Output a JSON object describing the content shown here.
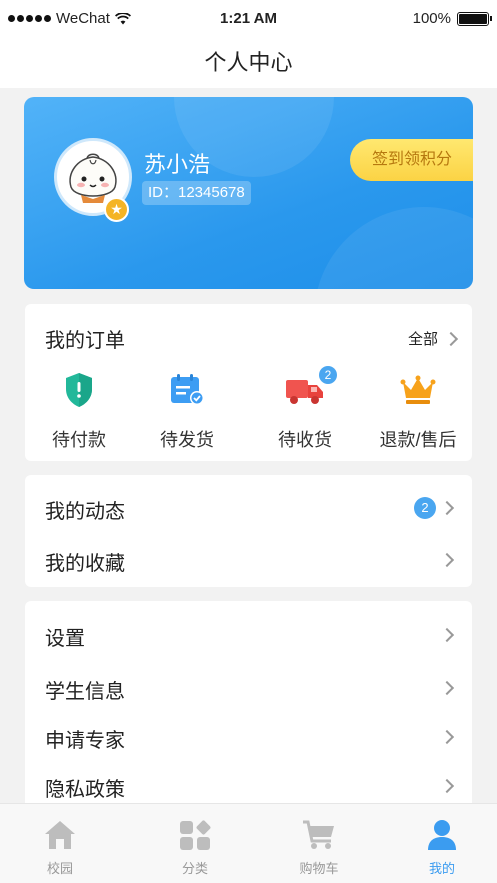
{
  "status_bar": {
    "carrier": "WeChat",
    "time": "1:21 AM",
    "battery": "100%"
  },
  "nav": {
    "title": "个人中心"
  },
  "profile": {
    "name": "苏小浩",
    "id_text": "ID：12345678",
    "checkin_label": "签到领积分"
  },
  "orders": {
    "title": "我的订单",
    "all_label": "全部",
    "items": [
      {
        "label": "待付款",
        "icon": "shield-icon",
        "color": "#22b89a"
      },
      {
        "label": "待发货",
        "icon": "calendar-check-icon",
        "color": "#3d9df3"
      },
      {
        "label": "待收货",
        "icon": "truck-icon",
        "color": "#f0544f",
        "badge": "2"
      },
      {
        "label": "退款/售后",
        "icon": "crown-icon",
        "color": "#f7a21b"
      }
    ]
  },
  "activity": {
    "items": [
      {
        "label": "我的动态",
        "badge": "2"
      },
      {
        "label": "我的收藏"
      }
    ]
  },
  "settings": {
    "items": [
      {
        "label": "设置"
      },
      {
        "label": "学生信息"
      },
      {
        "label": "申请专家"
      },
      {
        "label": "隐私政策"
      }
    ]
  },
  "tabbar": {
    "items": [
      {
        "label": "校园",
        "icon": "home-icon"
      },
      {
        "label": "分类",
        "icon": "category-icon"
      },
      {
        "label": "购物车",
        "icon": "cart-icon"
      },
      {
        "label": "我的",
        "icon": "user-icon",
        "active": true
      }
    ],
    "active_color": "#3b9cf0",
    "inactive_color": "#bdbdbd"
  }
}
